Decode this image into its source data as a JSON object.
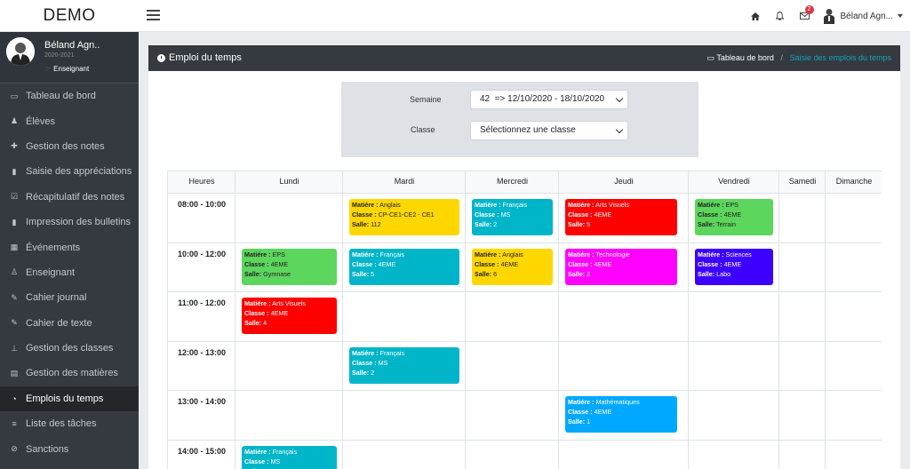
{
  "brand": "DEMO",
  "topbar": {
    "notif_count": "2",
    "user": "Béland Agn..."
  },
  "user_panel": {
    "name": "Béland Agn..",
    "year": "2020-2021",
    "role": "Enseignant"
  },
  "nav": [
    {
      "label": "Tableau de bord",
      "icon": "laptop-icon"
    },
    {
      "label": "Élèves",
      "icon": "user-icon"
    },
    {
      "label": "Gestion des notes",
      "icon": "puzzle-icon"
    },
    {
      "label": "Saisie des appréciations",
      "icon": "file-icon"
    },
    {
      "label": "Récapitulatif des notes",
      "icon": "check-square-icon"
    },
    {
      "label": "Impression des bulletins",
      "icon": "file-icon"
    },
    {
      "label": "Événements",
      "icon": "calendar-icon"
    },
    {
      "label": "Enseignant",
      "icon": "user-tie-icon"
    },
    {
      "label": "Cahier journal",
      "icon": "edit-icon"
    },
    {
      "label": "Cahier de texte",
      "icon": "edit-icon"
    },
    {
      "label": "Gestion des classes",
      "icon": "sitemap-icon"
    },
    {
      "label": "Gestion des matières",
      "icon": "table-icon"
    },
    {
      "label": "Emplois du temps",
      "icon": "clock-icon",
      "active": true
    },
    {
      "label": "Liste des tâches",
      "icon": "list-icon"
    },
    {
      "label": "Sanctions",
      "icon": "ban-icon"
    }
  ],
  "page": {
    "title": "Emploi du temps",
    "breadcrumb_home": "Tableau de bord",
    "breadcrumb_sep": "/",
    "breadcrumb_current": "Saisie des emplois du temps"
  },
  "filter": {
    "semaine_label": "Semaine",
    "semaine_value": "42  => 12/10/2020 - 18/10/2020",
    "classe_label": "Classe",
    "classe_value": "Sélectionnez une classe"
  },
  "timetable": {
    "headers": [
      "Heures",
      "Lundi",
      "Mardi",
      "Mercredi",
      "Jeudi",
      "Vendredi",
      "Samedi",
      "Dimanche"
    ],
    "hours": [
      "08:00 - 10:00",
      "10:00 - 12:00",
      "11:00 - 12:00",
      "12:00 - 13:00",
      "13:00 - 14:00",
      "14:00 - 15:00"
    ],
    "labels": {
      "matiere": "Matiére :",
      "classe": "Classe :",
      "salle": "Salle:"
    },
    "events": [
      {
        "day": 2,
        "row": 0,
        "matiere": "Anglais",
        "classe": "CP-CE1-CE2 - CE1",
        "salle": "112",
        "color": "#ffd700",
        "dark": true
      },
      {
        "day": 3,
        "row": 0,
        "matiere": "Français",
        "classe": "MS",
        "salle": "2",
        "color": "#00b5c8",
        "dark": false
      },
      {
        "day": 4,
        "row": 0,
        "matiere": "Arts Visuels",
        "classe": "4EME",
        "salle": "5",
        "color": "#ff0000",
        "dark": false
      },
      {
        "day": 5,
        "row": 0,
        "matiere": "EPS",
        "classe": "4EME",
        "salle": "Terrain",
        "color": "#5cd65c",
        "dark": true
      },
      {
        "day": 1,
        "row": 1,
        "matiere": "EPS",
        "classe": "4EME",
        "salle": "Gymnase",
        "color": "#5cd65c",
        "dark": true
      },
      {
        "day": 2,
        "row": 1,
        "matiere": "Français",
        "classe": "4EME",
        "salle": "5",
        "color": "#00b5c8",
        "dark": false
      },
      {
        "day": 3,
        "row": 1,
        "matiere": "Anglais",
        "classe": "4EME",
        "salle": "6",
        "color": "#ffd700",
        "dark": true
      },
      {
        "day": 4,
        "row": 1,
        "matiere": "Technologie",
        "classe": "4EME",
        "salle": "2",
        "color": "#ff00ff",
        "dark": false
      },
      {
        "day": 5,
        "row": 1,
        "matiere": "Sciences",
        "classe": "4EME",
        "salle": "Labo",
        "color": "#3d00ff",
        "dark": false
      },
      {
        "day": 1,
        "row": 2,
        "matiere": "Arts Visuels",
        "classe": "4EME",
        "salle": "4",
        "color": "#ff0000",
        "dark": false
      },
      {
        "day": 2,
        "row": 3,
        "matiere": "Français",
        "classe": "MS",
        "salle": "2",
        "color": "#00b5c8",
        "dark": false
      },
      {
        "day": 4,
        "row": 4,
        "matiere": "Mathématiques",
        "classe": "4EME",
        "salle": "1",
        "color": "#00a8ff",
        "dark": false
      },
      {
        "day": 1,
        "row": 5,
        "matiere": "Français",
        "classe": "MS",
        "salle": "",
        "color": "#00b5c8",
        "dark": false
      }
    ]
  }
}
